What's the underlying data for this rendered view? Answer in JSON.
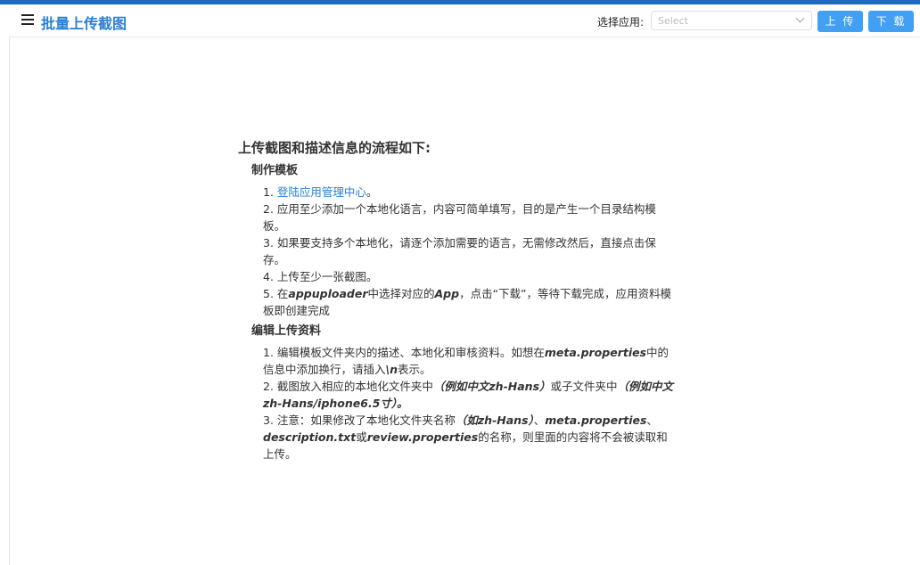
{
  "header": {
    "title": "批量上传截图",
    "app_label": "选择应用:",
    "select_placeholder": "Select",
    "upload_label": "上 传",
    "download_label": "下 载"
  },
  "guide": {
    "heading": "上传截图和描述信息的流程如下:",
    "sections": [
      {
        "title": "制作模板",
        "steps": [
          {
            "segments": [
              {
                "t": "1. "
              },
              {
                "t": "登陆应用管理中心",
                "link": true
              },
              {
                "t": "。"
              }
            ]
          },
          {
            "segments": [
              {
                "t": "2. 应用至少添加一个本地化语言，内容可简单填写，目的是产生一个目录结构模板。"
              }
            ]
          },
          {
            "segments": [
              {
                "t": "3. 如果要支持多个本地化，请逐个添加需要的语言，无需修改然后，直接点击保存。"
              }
            ]
          },
          {
            "segments": [
              {
                "t": "4. 上传至少一张截图。"
              }
            ]
          },
          {
            "segments": [
              {
                "t": "5. 在"
              },
              {
                "t": "appuploader",
                "em": true
              },
              {
                "t": "中选择对应的"
              },
              {
                "t": "App",
                "em": true
              },
              {
                "t": "，点击“下载”，等待下载完成，应用资料模板即创建完成"
              }
            ]
          }
        ]
      },
      {
        "title": "编辑上传资料",
        "steps": [
          {
            "segments": [
              {
                "t": "1. 编辑模板文件夹内的描述、本地化和审核资料。如想在"
              },
              {
                "t": "meta.properties",
                "em": true
              },
              {
                "t": "中的信息中添加换行，请插入"
              },
              {
                "t": "\\n",
                "em": true
              },
              {
                "t": "表示。"
              }
            ]
          },
          {
            "segments": [
              {
                "t": "2. 截图放入相应的本地化文件夹中"
              },
              {
                "t": "（例如中文zh-Hans）",
                "em": true
              },
              {
                "t": "或子文件夹中"
              },
              {
                "t": "（例如中文zh-Hans/iphone6.5寸）。",
                "em": true
              }
            ]
          },
          {
            "segments": [
              {
                "t": "3. 注意：如果修改了本地化文件夹名称"
              },
              {
                "t": "（如zh-Hans）",
                "em": true
              },
              {
                "t": "、"
              },
              {
                "t": "meta.properties",
                "em": true
              },
              {
                "t": "、"
              },
              {
                "t": "description.txt",
                "em": true
              },
              {
                "t": "或"
              },
              {
                "t": "review.properties",
                "em": true
              },
              {
                "t": "的名称，则里面的内容将不会被读取和上传。"
              }
            ]
          }
        ]
      }
    ]
  }
}
